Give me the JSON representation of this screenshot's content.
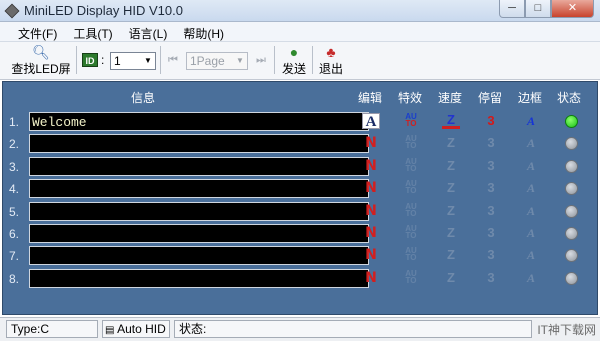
{
  "window": {
    "title": "MiniLED Display HID V10.0",
    "minimize": "─",
    "maximize": "□",
    "close": "✕"
  },
  "menu": [
    "文件(F)",
    "工具(T)",
    "语言(L)",
    "帮助(H)"
  ],
  "toolbar": {
    "find_led_label": "查找LED屏",
    "id_badge": "ID",
    "id_colon": ":",
    "id_select_value": "1",
    "page_select_value": "1Page",
    "send_label": "发送",
    "exit_label": "退出"
  },
  "grid": {
    "headers": {
      "info": "信息",
      "edit": "编辑",
      "effect": "特效",
      "speed": "速度",
      "stay": "停留",
      "border": "边框",
      "status": "状态"
    },
    "rows": [
      {
        "num": "1.",
        "text": "Welcome",
        "active": true
      },
      {
        "num": "2.",
        "text": "",
        "active": false
      },
      {
        "num": "3.",
        "text": "",
        "active": false
      },
      {
        "num": "4.",
        "text": "",
        "active": false
      },
      {
        "num": "5.",
        "text": "",
        "active": false
      },
      {
        "num": "6.",
        "text": "",
        "active": false
      },
      {
        "num": "7.",
        "text": "",
        "active": false
      },
      {
        "num": "8.",
        "text": "",
        "active": false
      }
    ],
    "icon_glyphs": {
      "edit_active": "A",
      "edit_inactive": "N",
      "effect_top": "AU",
      "effect_bottom": "TO",
      "speed": "Z",
      "stay": "3",
      "border": "A"
    }
  },
  "statusbar": {
    "type": "Type:C",
    "mode": "Auto HID",
    "status_label": "状态:",
    "watermark": "IT神下载网"
  },
  "colors": {
    "grid_bg": "#4a6f9a",
    "status_on": "#18c018",
    "status_off": "#8d939b"
  }
}
